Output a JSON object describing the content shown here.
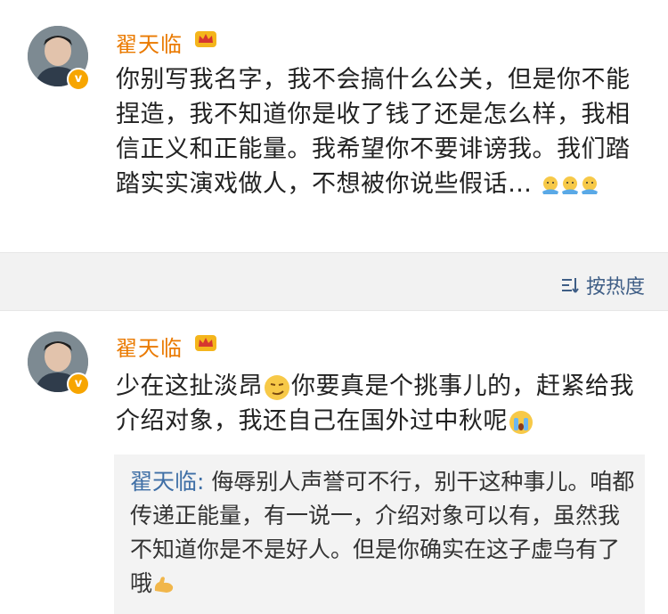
{
  "comment1": {
    "username": "翟天临",
    "text": "你别写我名字，我不会搞什么公关，但是你不能捏造，我不知道你是收了钱了还是怎么样，我相信正义和正能量。我希望你不要诽谤我。我们踏踏实实演戏做人，不想被你说些假话…",
    "emojis": [
      "hug-emoji",
      "hug-emoji",
      "hug-emoji"
    ]
  },
  "sort_bar": {
    "label": "按热度",
    "icon": "sort-icon"
  },
  "comment2": {
    "username": "翟天临",
    "text_part1": "少在这扯淡昂",
    "text_part2": "你要真是个挑事儿的，赶紧给我介绍对象，我还自己在国外过中秋呢",
    "quote_name": "翟天临:",
    "quote_text": " 侮辱别人声誉可不行，别干这种事儿。咱都传递正能量，有一说一，介绍对象可以有，虽然我不知道你是不是好人。但是你确实在这子虚乌有了哦"
  },
  "colors": {
    "username": "#ea7a00",
    "link": "#3f6fa6",
    "verified": "#f7a500",
    "background": "#f1f1f1"
  }
}
